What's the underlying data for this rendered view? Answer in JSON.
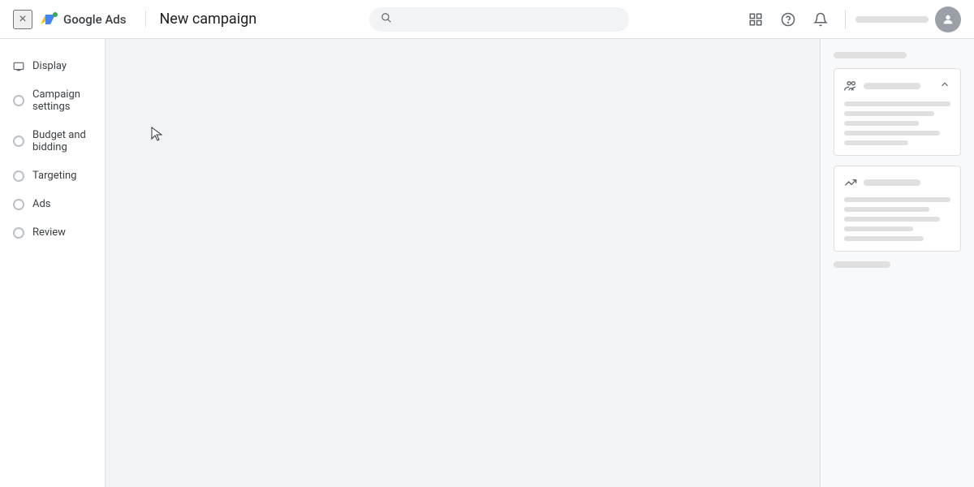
{
  "app": {
    "title": "Google Ads",
    "page_title": "New campaign"
  },
  "topbar": {
    "close_label": "×",
    "search_placeholder": "",
    "icons": {
      "collections": "▦",
      "help": "?",
      "notifications": "🔔"
    }
  },
  "sidebar": {
    "display_item": {
      "label": "Display",
      "icon": "display"
    },
    "items": [
      {
        "id": "campaign-settings",
        "label": "Campaign settings"
      },
      {
        "id": "budget-bidding",
        "label": "Budget and bidding"
      },
      {
        "id": "targeting",
        "label": "Targeting"
      },
      {
        "id": "ads",
        "label": "Ads"
      },
      {
        "id": "review",
        "label": "Review"
      }
    ]
  },
  "right_panel": {
    "card1": {
      "title_placeholder": "",
      "lines": [
        3,
        2,
        1
      ]
    },
    "card2": {
      "title_placeholder": "",
      "lines": [
        3,
        2,
        1
      ]
    }
  }
}
